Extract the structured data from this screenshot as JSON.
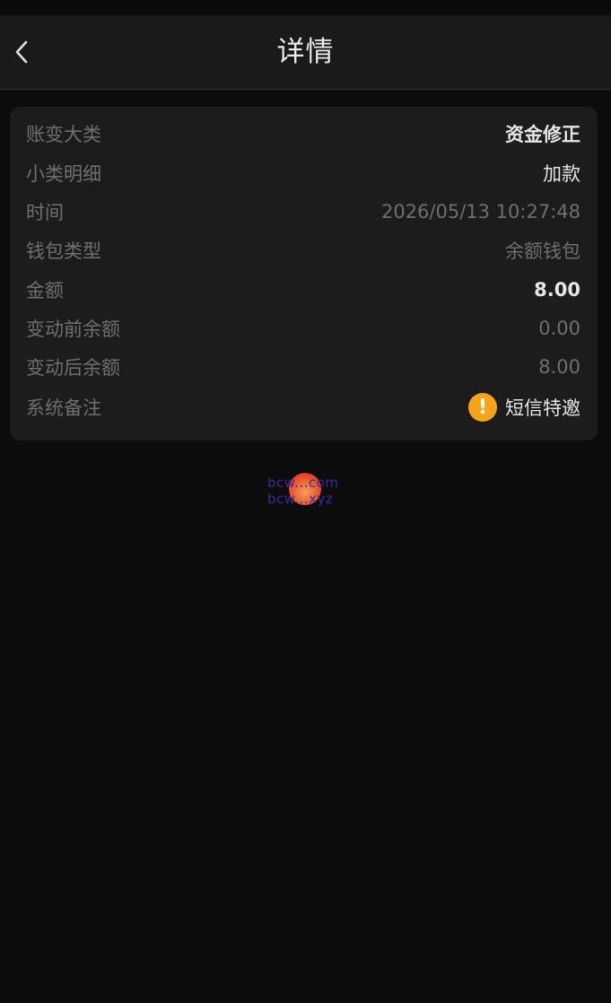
{
  "header": {
    "title": "详情"
  },
  "details": [
    {
      "label": "账变大类",
      "value": "资金修正"
    },
    {
      "label": "小类明细",
      "value": "加款"
    },
    {
      "label": "时间",
      "value": "2026/05/13 10:27:48"
    },
    {
      "label": "钱包类型",
      "value": "余额钱包"
    },
    {
      "label": "金额",
      "value": "8.00"
    },
    {
      "label": "变动前余额",
      "value": "0.00"
    },
    {
      "label": "变动后余额",
      "value": "8.00"
    },
    {
      "label": "系统备注",
      "value": "短信特邀"
    }
  ],
  "watermark": {
    "line1": "bcw...com",
    "line2": "bcw...xyz"
  },
  "colors": {
    "background": "#0c0c0c",
    "card": "#1c1c1c",
    "navbar": "#1a1a1a",
    "label": "#6f6f6f",
    "value_highlight": "#e6e6e6",
    "warning": "#f7a21b"
  },
  "icons": {
    "back": "chevron-left-icon",
    "remark": "exclamation-circle-icon"
  }
}
